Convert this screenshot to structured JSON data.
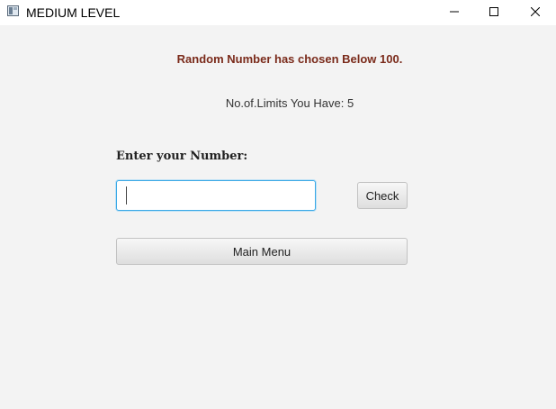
{
  "window": {
    "title": "MEDIUM LEVEL",
    "icon": "app-window-icon",
    "controls": [
      "minimize-icon",
      "maximize-icon",
      "close-icon"
    ]
  },
  "game": {
    "headline": "Random Number has chosen Below 100.",
    "limits_text": "No.of.Limits You Have: 5",
    "prompt_label": "Enter your Number:",
    "number_input": {
      "value": "",
      "placeholder": ""
    },
    "check_label": "Check",
    "main_menu_label": "Main Menu"
  },
  "colors": {
    "headline": "#7a2a1a",
    "focus_border": "#3ba9e6",
    "background": "#f3f3f3"
  }
}
